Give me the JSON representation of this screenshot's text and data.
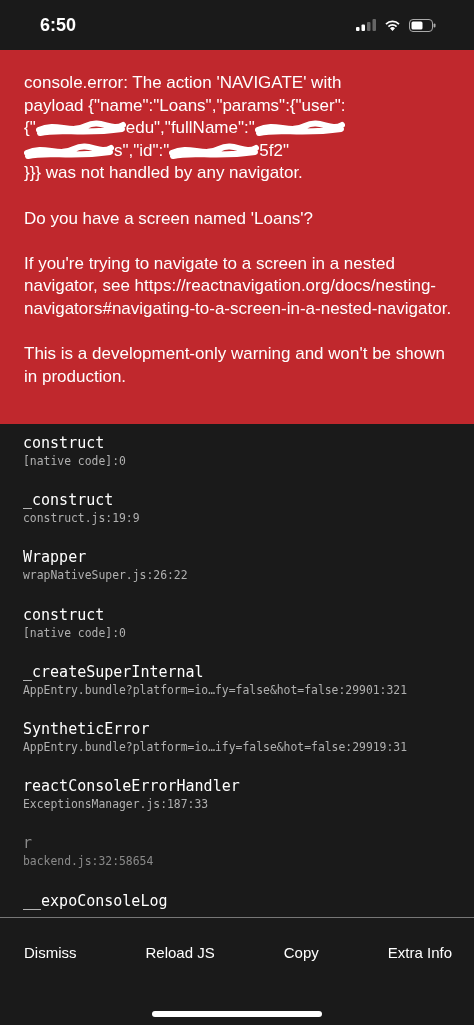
{
  "status_bar": {
    "time": "6:50"
  },
  "error": {
    "lines": [
      [
        {
          "kind": "text",
          "text": "console.error: The action 'NAVIGATE' with"
        }
      ],
      [
        {
          "kind": "text",
          "text": "payload {\"name\":\"Loans\",\"params\":{\"user\":"
        }
      ],
      [
        {
          "kind": "text",
          "text": "{\""
        },
        {
          "kind": "redacted"
        },
        {
          "kind": "text",
          "text": "edu\",\"fullName\":\""
        },
        {
          "kind": "redacted"
        }
      ],
      [
        {
          "kind": "redacted"
        },
        {
          "kind": "text",
          "text": "s\",\"id\":\""
        },
        {
          "kind": "redacted"
        },
        {
          "kind": "text",
          "text": "5f2\""
        }
      ],
      [
        {
          "kind": "text",
          "text": "}}} was not handled by any navigator."
        }
      ]
    ],
    "paragraphs": [
      "Do you have a screen named 'Loans'?",
      "If you're trying to navigate to a screen in a nested navigator, see https://reactnavigation.org/docs/nesting-navigators#navigating-to-a-screen-in-a-nested-navigator.",
      "This is a development-only warning and won't be shown in production."
    ]
  },
  "stack": [
    {
      "method": "construct",
      "file": "[native code]:0",
      "dimmed": false
    },
    {
      "method": "_construct",
      "file": "construct.js:19:9",
      "dimmed": false
    },
    {
      "method": "Wrapper",
      "file": "wrapNativeSuper.js:26:22",
      "dimmed": false
    },
    {
      "method": "construct",
      "file": "[native code]:0",
      "dimmed": false
    },
    {
      "method": "_createSuperInternal",
      "file": "AppEntry.bundle?platform=io…fy=false&hot=false:29901:321",
      "dimmed": false
    },
    {
      "method": "SyntheticError",
      "file": "AppEntry.bundle?platform=io…ify=false&hot=false:29919:31",
      "dimmed": false
    },
    {
      "method": "reactConsoleErrorHandler",
      "file": "ExceptionsManager.js:187:33",
      "dimmed": false
    },
    {
      "method": "r",
      "file": "backend.js:32:58654",
      "dimmed": true
    },
    {
      "method": "__expoConsoleLog",
      "dimmed": false
    }
  ],
  "buttons": [
    "Dismiss",
    "Reload JS",
    "Copy",
    "Extra Info"
  ]
}
